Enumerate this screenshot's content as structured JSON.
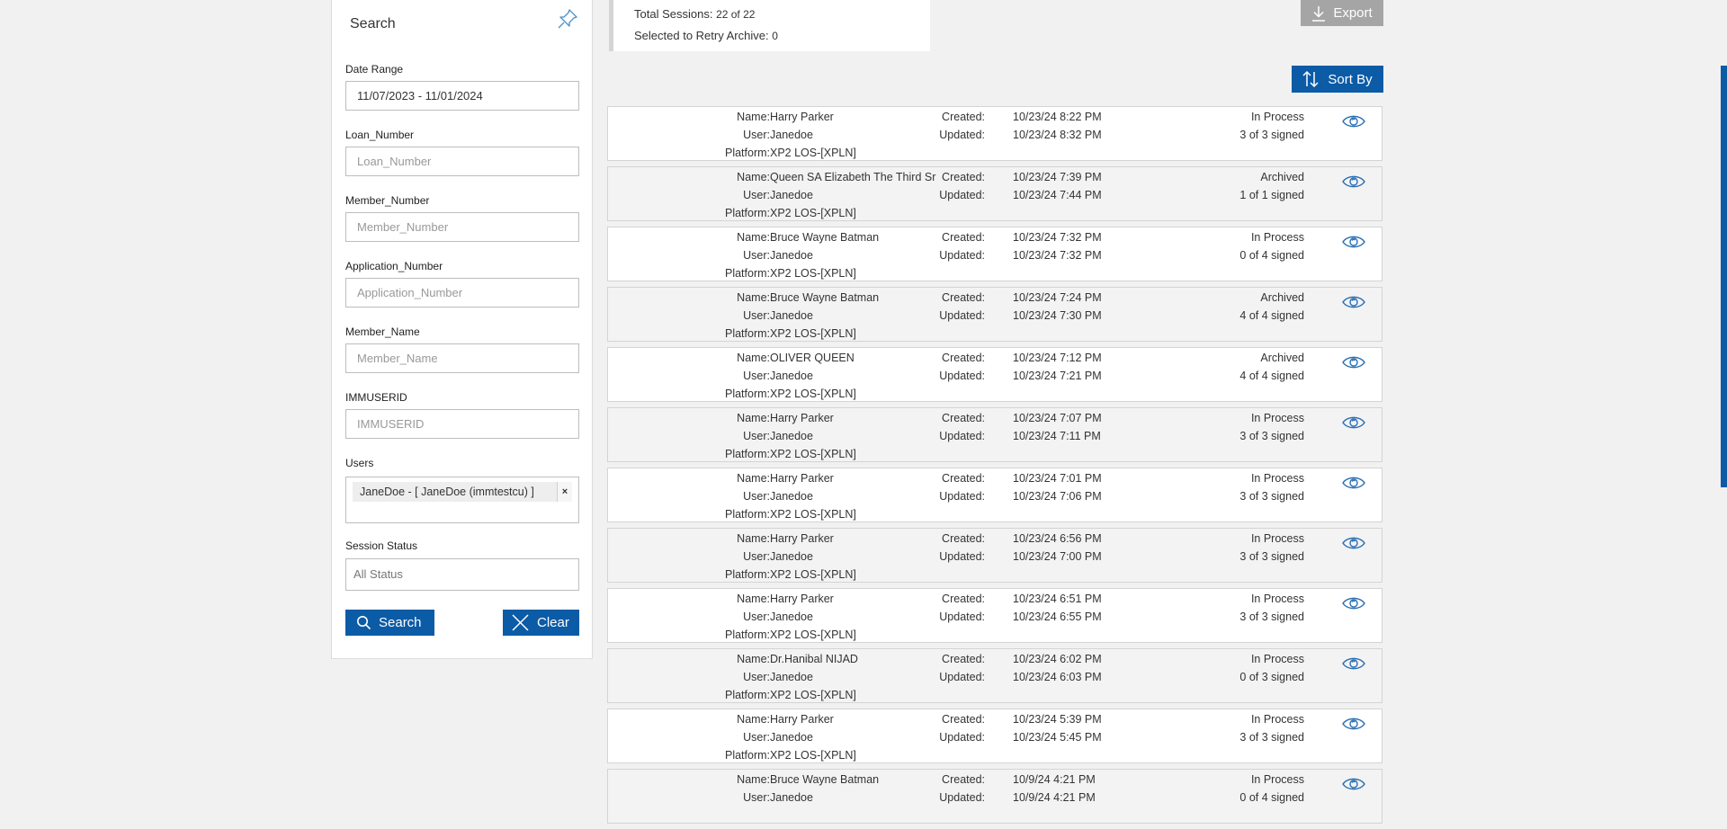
{
  "search_panel": {
    "title": "Search",
    "fields": [
      {
        "label": "Date Range",
        "value": "11/07/2023 - 11/01/2024",
        "placeholder": ""
      },
      {
        "label": "Loan_Number",
        "value": "",
        "placeholder": "Loan_Number"
      },
      {
        "label": "Member_Number",
        "value": "",
        "placeholder": "Member_Number"
      },
      {
        "label": "Application_Number",
        "value": "",
        "placeholder": "Application_Number"
      },
      {
        "label": "Member_Name",
        "value": "",
        "placeholder": "Member_Name"
      },
      {
        "label": "IMMUSERID",
        "value": "",
        "placeholder": "IMMUSERID"
      }
    ],
    "users_label": "Users",
    "selected_user": "JaneDoe - [ JaneDoe (immtestcu) ]",
    "chip_remove": "×",
    "status_label": "Session Status",
    "status_value": "All Status",
    "search_button": "Search",
    "clear_button": "Clear"
  },
  "summary": {
    "total_label": "Total Sessions:",
    "total_value": "22 of 22",
    "selected_label": "Selected to Retry Archive:",
    "selected_value": "0"
  },
  "toolbar": {
    "export_label": "Export",
    "sortby_label": "Sort By"
  },
  "labels": {
    "name": "Name:",
    "user": "User:",
    "platform": "Platform:",
    "created": "Created:",
    "updated": "Updated:"
  },
  "sessions": [
    {
      "name": "Harry Parker",
      "user": "Janedoe",
      "platform": "XP2 LOS-[XPLN]",
      "created": "10/23/24 8:22 PM",
      "updated": "10/23/24 8:32 PM",
      "status": "In Process",
      "signed": "3 of 3 signed"
    },
    {
      "name": "Queen SA Elizabeth The Third Sr",
      "user": "Janedoe",
      "platform": "XP2 LOS-[XPLN]",
      "created": "10/23/24 7:39 PM",
      "updated": "10/23/24 7:44 PM",
      "status": "Archived",
      "signed": "1 of 1 signed"
    },
    {
      "name": "Bruce Wayne Batman",
      "user": "Janedoe",
      "platform": "XP2 LOS-[XPLN]",
      "created": "10/23/24 7:32 PM",
      "updated": "10/23/24 7:32 PM",
      "status": "In Process",
      "signed": "0 of 4 signed"
    },
    {
      "name": "Bruce Wayne Batman",
      "user": "Janedoe",
      "platform": "XP2 LOS-[XPLN]",
      "created": "10/23/24 7:24 PM",
      "updated": "10/23/24 7:30 PM",
      "status": "Archived",
      "signed": "4 of 4 signed"
    },
    {
      "name": "OLIVER QUEEN",
      "user": "Janedoe",
      "platform": "XP2 LOS-[XPLN]",
      "created": "10/23/24 7:12 PM",
      "updated": "10/23/24 7:21 PM",
      "status": "Archived",
      "signed": "4 of 4 signed"
    },
    {
      "name": "Harry Parker",
      "user": "Janedoe",
      "platform": "XP2 LOS-[XPLN]",
      "created": "10/23/24 7:07 PM",
      "updated": "10/23/24 7:11 PM",
      "status": "In Process",
      "signed": "3 of 3 signed"
    },
    {
      "name": "Harry Parker",
      "user": "Janedoe",
      "platform": "XP2 LOS-[XPLN]",
      "created": "10/23/24 7:01 PM",
      "updated": "10/23/24 7:06 PM",
      "status": "In Process",
      "signed": "3 of 3 signed"
    },
    {
      "name": "Harry Parker",
      "user": "Janedoe",
      "platform": "XP2 LOS-[XPLN]",
      "created": "10/23/24 6:56 PM",
      "updated": "10/23/24 7:00 PM",
      "status": "In Process",
      "signed": "3 of 3 signed"
    },
    {
      "name": "Harry Parker",
      "user": "Janedoe",
      "platform": "XP2 LOS-[XPLN]",
      "created": "10/23/24 6:51 PM",
      "updated": "10/23/24 6:55 PM",
      "status": "In Process",
      "signed": "3 of 3 signed"
    },
    {
      "name": "Dr.Hanibal NIJAD",
      "user": "Janedoe",
      "platform": "XP2 LOS-[XPLN]",
      "created": "10/23/24 6:02 PM",
      "updated": "10/23/24 6:03 PM",
      "status": "In Process",
      "signed": "0 of 3 signed"
    },
    {
      "name": "Harry Parker",
      "user": "Janedoe",
      "platform": "XP2 LOS-[XPLN]",
      "created": "10/23/24 5:39 PM",
      "updated": "10/23/24 5:45 PM",
      "status": "In Process",
      "signed": "3 of 3 signed"
    },
    {
      "name": "Bruce Wayne Batman",
      "user": "Janedoe",
      "platform": "",
      "created": "10/9/24 4:21 PM",
      "updated": "10/9/24 4:21 PM",
      "status": "In Process",
      "signed": "0 of 4 signed"
    }
  ],
  "colors": {
    "primary": "#0b5ba6",
    "export_disabled": "#a5a5a5",
    "background": "#f1f1f1",
    "eye_icon": "#2a6fb3"
  },
  "icons": {
    "pin": "pin-icon",
    "search": "search-icon",
    "clear": "close-icon",
    "export": "download-icon",
    "sort": "sort-icon",
    "view": "eye-icon"
  }
}
